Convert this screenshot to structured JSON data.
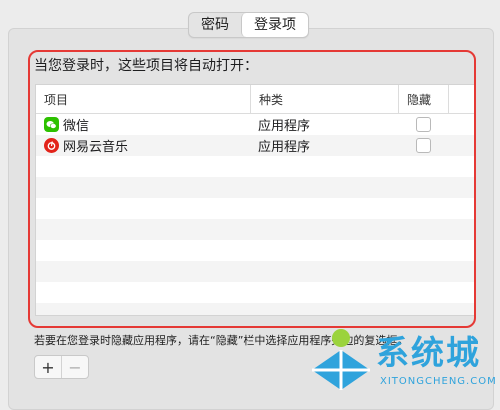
{
  "tabs": [
    {
      "label": "密码",
      "active": false
    },
    {
      "label": "登录项",
      "active": true
    }
  ],
  "heading": "当您登录时，这些项目将自动打开：",
  "table": {
    "columns": [
      "项目",
      "种类",
      "隐藏"
    ],
    "rows": [
      {
        "name": "微信",
        "type": "应用程序",
        "hidden": false,
        "icon": "wechat-icon",
        "icon_color": "#2dc100"
      },
      {
        "name": "网易云音乐",
        "type": "应用程序",
        "hidden": false,
        "icon": "netease-music-icon",
        "icon_color": "#e2231a"
      }
    ]
  },
  "note": "若要在您登录时隐藏应用程序，请在“隐藏”栏中选择应用程序旁边的复选框。",
  "buttons": {
    "add": "+",
    "remove": "−"
  },
  "watermark": {
    "text": "系统城",
    "sub": "XITONGCHENG.COM",
    "icon": "watermark-logo-icon"
  },
  "colors": {
    "highlight": "#e53935",
    "watermark": "#2fa3dc"
  }
}
